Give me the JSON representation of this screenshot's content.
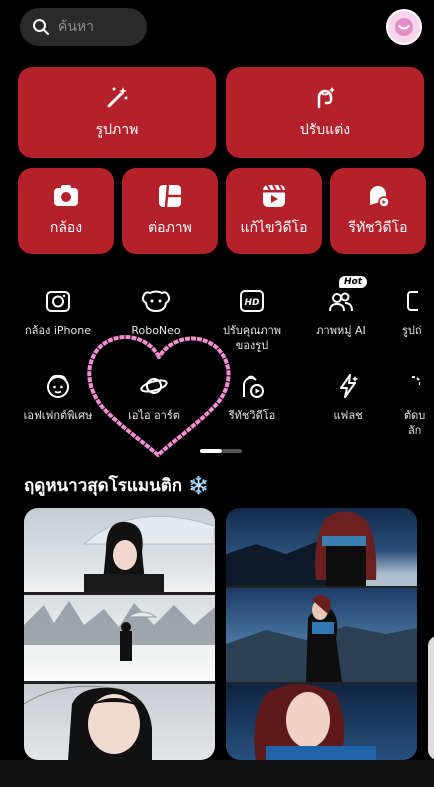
{
  "search": {
    "placeholder": "ค้นหา"
  },
  "main_cards": [
    {
      "label": "รูปภาพ",
      "icon": "magic-wand-icon"
    },
    {
      "label": "ปรับแต่ง",
      "icon": "face-retouch-icon"
    }
  ],
  "quick_cards": [
    {
      "label": "กล้อง",
      "icon": "camera-icon"
    },
    {
      "label": "ต่อภาพ",
      "icon": "collage-icon"
    },
    {
      "label": "แก้ไขวิดีโอ",
      "icon": "video-edit-icon"
    },
    {
      "label": "รีทัชวิดีโอ",
      "icon": "video-retouch-icon"
    }
  ],
  "tools_row1": [
    {
      "label": "กล้อง iPhone",
      "icon": "iphone-camera-icon"
    },
    {
      "label": "RoboNeo",
      "icon": "roboneo-icon"
    },
    {
      "label": "ปรับคุณภาพ",
      "label2": "ของรูป",
      "icon": "hd-icon"
    },
    {
      "label": "ภาพหมู่ AI",
      "icon": "group-photo-icon",
      "badge": "Hot"
    },
    {
      "label": "รูปถ่",
      "icon": "partial-icon"
    }
  ],
  "tools_row2": [
    {
      "label": "เอฟเฟกต์พิเศษ",
      "icon": "effect-face-icon"
    },
    {
      "label": "เอไอ อาร์ต",
      "icon": "planet-icon"
    },
    {
      "label": "รีทัชวิดีโอ",
      "icon": "video-face-icon"
    },
    {
      "label": "แฟลช",
      "icon": "flash-icon"
    },
    {
      "label": "ตัดบ",
      "label2": "ลัก",
      "icon": "cutout-icon"
    }
  ],
  "section": {
    "title": "ฤดูหนาวสุดโรแมนติก",
    "emoji": "❄️"
  },
  "colors": {
    "card_red": "#b4212a",
    "background": "#000000",
    "heart_pink": "#f48fd3"
  }
}
